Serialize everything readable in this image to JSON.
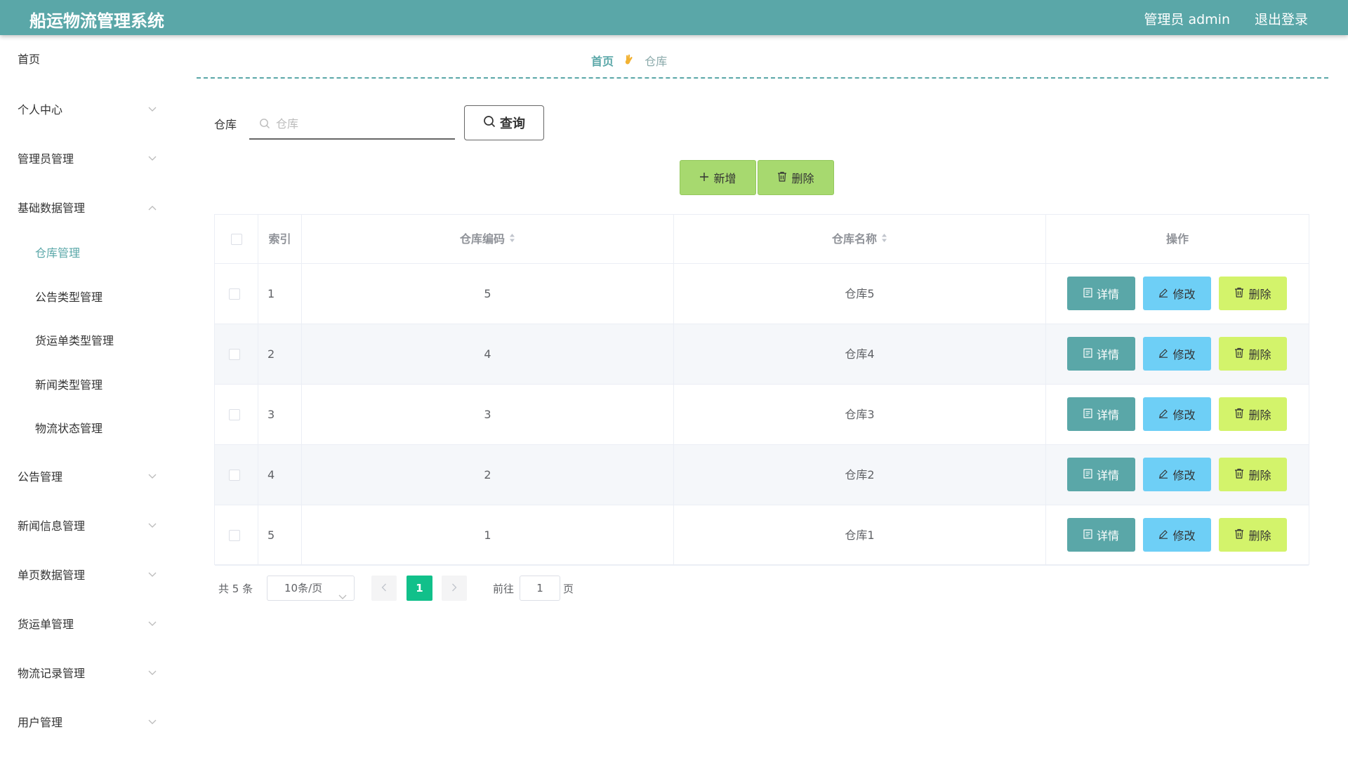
{
  "header": {
    "title": "船运物流管理系统",
    "user": "管理员 admin",
    "logout": "退出登录"
  },
  "sidebar": {
    "items": [
      {
        "label": "首页",
        "expandable": false
      },
      {
        "label": "个人中心",
        "expandable": true
      },
      {
        "label": "管理员管理",
        "expandable": true
      },
      {
        "label": "基础数据管理",
        "expandable": true,
        "expanded": true
      },
      {
        "label": "公告管理",
        "expandable": true
      },
      {
        "label": "新闻信息管理",
        "expandable": true
      },
      {
        "label": "单页数据管理",
        "expandable": true
      },
      {
        "label": "货运单管理",
        "expandable": true
      },
      {
        "label": "物流记录管理",
        "expandable": true
      },
      {
        "label": "用户管理",
        "expandable": true
      }
    ],
    "subitems": [
      {
        "label": "仓库管理",
        "active": true
      },
      {
        "label": "公告类型管理",
        "active": false
      },
      {
        "label": "货运单类型管理",
        "active": false
      },
      {
        "label": "新闻类型管理",
        "active": false
      },
      {
        "label": "物流状态管理",
        "active": false
      }
    ]
  },
  "breadcrumb": {
    "home": "首页",
    "current": "仓库"
  },
  "search": {
    "label": "仓库",
    "placeholder": "仓库",
    "value": "",
    "button": "查询"
  },
  "actions": {
    "add": "新增",
    "delete": "删除"
  },
  "table": {
    "columns": [
      "索引",
      "仓库编码",
      "仓库名称",
      "操作"
    ],
    "rows": [
      {
        "index": "1",
        "code": "5",
        "name": "仓库5"
      },
      {
        "index": "2",
        "code": "4",
        "name": "仓库4"
      },
      {
        "index": "3",
        "code": "3",
        "name": "仓库3"
      },
      {
        "index": "4",
        "code": "2",
        "name": "仓库2"
      },
      {
        "index": "5",
        "code": "1",
        "name": "仓库1"
      }
    ],
    "row_buttons": {
      "detail": "详情",
      "edit": "修改",
      "delete": "删除"
    }
  },
  "pagination": {
    "total": "共 5 条",
    "page_size": "10条/页",
    "current_page": "1",
    "goto_label": "前往",
    "goto_value": "1",
    "page_suffix": "页"
  },
  "colors": {
    "primary": "#5aa7a8",
    "add_button": "#a7d96f",
    "detail_button": "#5aa7a8",
    "edit_button": "#6ecff6",
    "delete_button": "#d3f36b",
    "active_page": "#11c08a"
  }
}
